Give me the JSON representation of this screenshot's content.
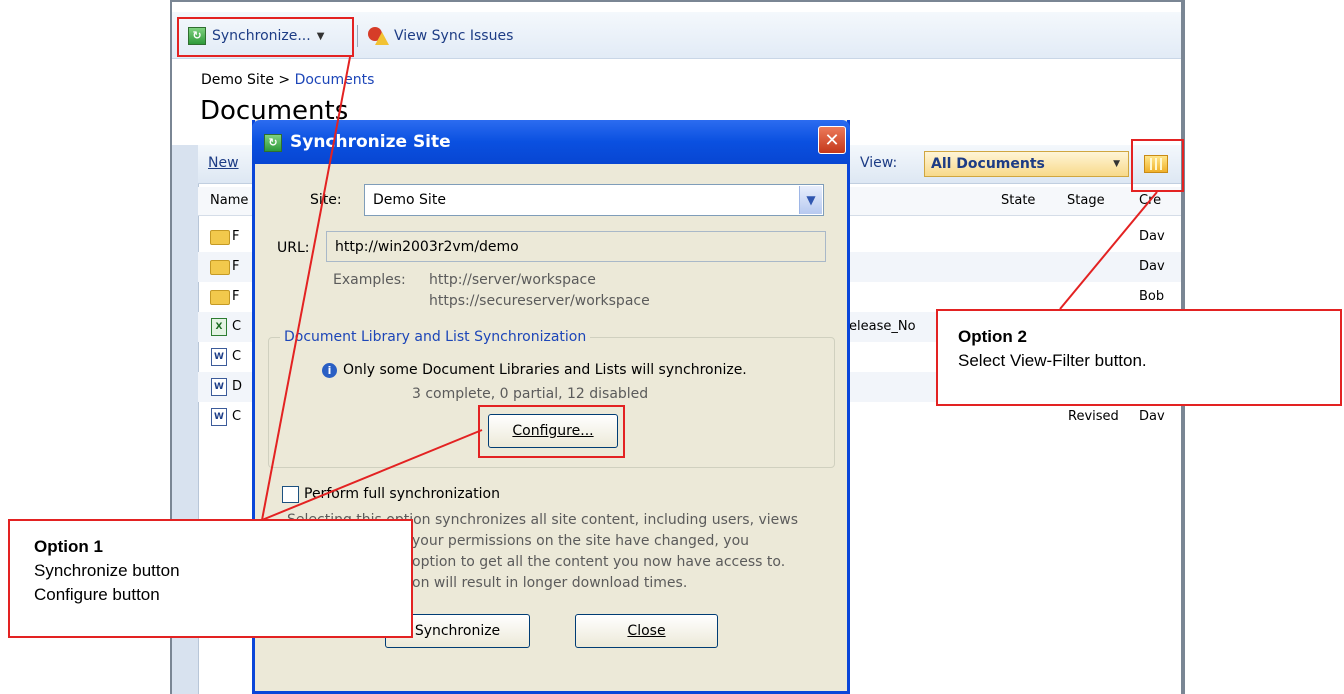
{
  "toolbar": {
    "synchronize_label": "Synchronize...",
    "view_sync_issues_label": "View Sync Issues"
  },
  "page": {
    "breadcrumb_root": "Demo Site",
    "breadcrumb_separator": ">",
    "breadcrumb_current": "Documents",
    "title": "Documents"
  },
  "library": {
    "new_label": "New",
    "view_label": "View:",
    "view_value": "All Documents",
    "columns": [
      "Name",
      "State",
      "Stage",
      "Cre"
    ],
    "rows": [
      {
        "name": "F",
        "state": "",
        "stage": "",
        "created": "Dav"
      },
      {
        "name": "F",
        "state": "",
        "stage": "",
        "created": "Dav"
      },
      {
        "name": "F",
        "state": "",
        "stage": "",
        "created": "Bob"
      },
      {
        "name": "C",
        "state": "",
        "stage": "",
        "created": "",
        "extra": "elease_No"
      },
      {
        "name": "C",
        "state": "",
        "stage": "",
        "created": ""
      },
      {
        "name": "D",
        "state": "",
        "stage": "",
        "created": ""
      },
      {
        "name": "C",
        "state": "",
        "stage": "Revised",
        "created": "Dav"
      }
    ]
  },
  "dialog": {
    "title": "Synchronize Site",
    "site_label": "Site:",
    "site_value": "Demo Site",
    "url_label": "URL:",
    "url_value": "http://win2003r2vm/demo",
    "examples_label": "Examples:",
    "example_1": "http://server/workspace",
    "example_2": "https://secureserver/workspace",
    "group_title": "Document Library and List Synchronization",
    "info_text": "Only some Document Libraries and Lists will synchronize.",
    "counts_text": "3 complete, 0 partial, 12 disabled",
    "configure_label": "Configure...",
    "full_sync_label": "Perform full synchronization",
    "description_1": "Selecting this option synchronizes all site content, including users, views",
    "description_2": "your permissions on the site have changed, you",
    "description_3": "option to get all the content you now have access to.",
    "description_4": "on will result in longer download times.",
    "synchronize_label": "Synchronize",
    "close_label": "Close"
  },
  "callouts": {
    "option1_title": "Option 1",
    "option1_line1": "Synchronize button",
    "option1_line2": "Configure button",
    "option2_title": "Option 2",
    "option2_line1": "Select View-Filter button."
  },
  "colors": {
    "callout_border": "#e32222",
    "dialog_title_blue": "#0a50e0",
    "link_blue": "#1d3c85"
  }
}
